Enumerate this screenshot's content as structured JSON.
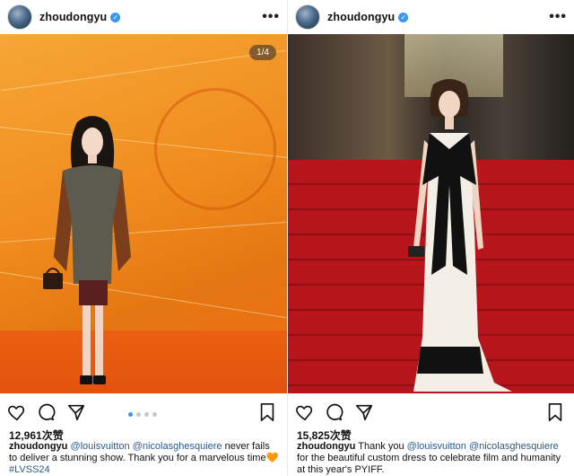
{
  "posts": [
    {
      "username": "zhoudongyu",
      "more": "•••",
      "counter": "1/4",
      "likes": "12,961次赞",
      "caption": {
        "user": "zhoudongyu",
        "mention1": "@louisvuitton",
        "mention2": "@nicolasghesquiere",
        "text": "never fails to deliver a stunning show. Thank you for a marvelous time🧡",
        "hashtag": "#LVSS24"
      },
      "carousel": {
        "count": 4,
        "active": 1
      },
      "icons": [
        "heart-icon",
        "comment-icon",
        "share-icon",
        "bookmark-icon"
      ]
    },
    {
      "username": "zhoudongyu",
      "more": "•••",
      "likes": "15,825次赞",
      "caption": {
        "user": "zhoudongyu",
        "before": "Thank you",
        "mention1": "@louisvuitton",
        "mention2": "@nicolasghesquiere",
        "text": "for the beautiful custom dress to celebrate film and humanity at this year's PYIFF."
      },
      "icons": [
        "heart-icon",
        "comment-icon",
        "share-icon",
        "bookmark-icon"
      ]
    }
  ],
  "colors": {
    "accent": "#3897f0",
    "link": "#2c5a8a",
    "lv_orange": "#f08c1e",
    "carpet_red": "#b5151b"
  }
}
